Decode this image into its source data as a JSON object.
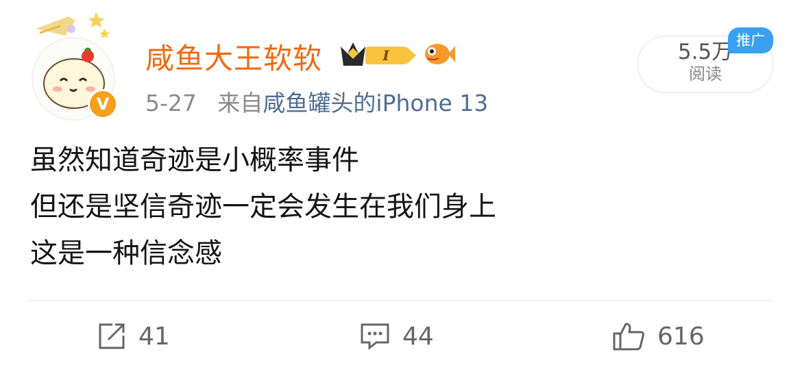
{
  "post": {
    "user": {
      "name": "咸鱼大王软软",
      "verified_icon": "v-badge-icon",
      "vip_level": "I"
    },
    "meta": {
      "date": "5-27",
      "from_prefix": "来自",
      "source": "咸鱼罐头的iPhone 13"
    },
    "reads": {
      "count": "5.5万",
      "label": "阅读",
      "promo": "推广"
    },
    "content": {
      "lines": [
        "虽然知道奇迹是小概率事件",
        "但还是坚信奇迹一定会发生在我们身上",
        "这是一种信念感"
      ]
    },
    "actions": {
      "repost": "41",
      "comment": "44",
      "like": "616"
    }
  },
  "colors": {
    "name": "#f06a10",
    "source": "#4d6d93",
    "promo": "#3aa0f0",
    "verified": "#f79f1a"
  }
}
